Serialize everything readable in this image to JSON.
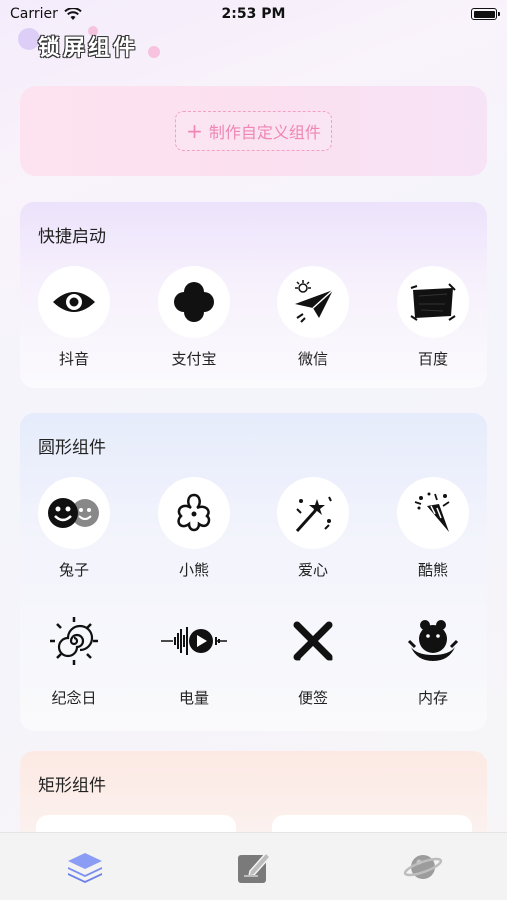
{
  "status_bar": {
    "carrier": "Carrier",
    "time": "2:53 PM"
  },
  "page": {
    "title": "锁屏组件"
  },
  "create": {
    "plus": "+",
    "label": "制作自定义组件"
  },
  "quick_launch": {
    "title": "快捷启动",
    "items": [
      {
        "label": "抖音",
        "icon": "eye-icon"
      },
      {
        "label": "支付宝",
        "icon": "clover-icon"
      },
      {
        "label": "微信",
        "icon": "paper-plane-icon"
      },
      {
        "label": "百度",
        "icon": "scribble-icon"
      }
    ]
  },
  "round_widgets": {
    "title": "圆形组件",
    "items": [
      {
        "label": "兔子",
        "icon": "smiley-faces-icon"
      },
      {
        "label": "小熊",
        "icon": "flower-icon"
      },
      {
        "label": "爱心",
        "icon": "magic-wand-icon"
      },
      {
        "label": "酷熊",
        "icon": "party-popper-icon"
      },
      {
        "label": "纪念日",
        "icon": "sun-spiral-icon"
      },
      {
        "label": "电量",
        "icon": "sound-wave-icon"
      },
      {
        "label": "便签",
        "icon": "x-mark-icon"
      },
      {
        "label": "内存",
        "icon": "bear-emblem-icon"
      }
    ]
  },
  "rect_widgets": {
    "title": "矩形组件"
  },
  "tabs": [
    {
      "name": "layers-icon",
      "active": true
    },
    {
      "name": "edit-icon",
      "active": false
    },
    {
      "name": "planet-icon",
      "active": false
    }
  ],
  "colors": {
    "accent_pink": "#ef86b4",
    "tab_active": "#7b8ef0"
  }
}
